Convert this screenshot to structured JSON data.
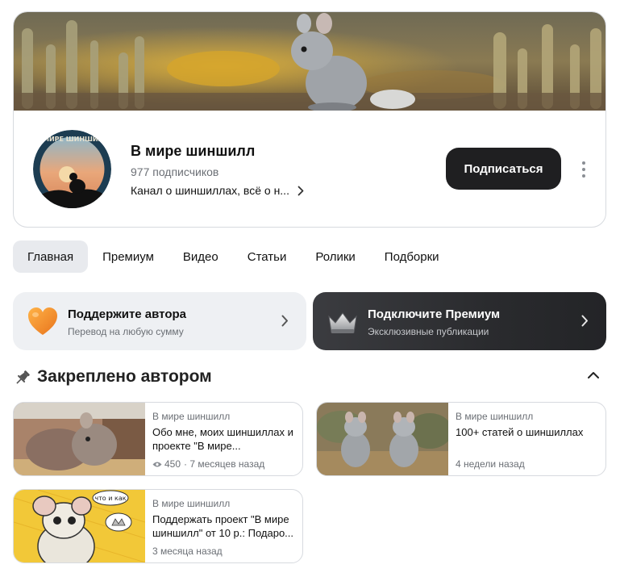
{
  "channel": {
    "name": "В мире шиншилл",
    "subscribers": "977 подписчиков",
    "description": "Канал о шиншиллах, всё о н...",
    "subscribe_label": "Подписаться",
    "avatar_text": "В МИРЕ ШИНШИЛЛ"
  },
  "tabs": [
    {
      "label": "Главная",
      "active": true
    },
    {
      "label": "Премиум"
    },
    {
      "label": "Видео"
    },
    {
      "label": "Статьи"
    },
    {
      "label": "Ролики"
    },
    {
      "label": "Подборки"
    }
  ],
  "promos": {
    "support": {
      "title": "Поддержите автора",
      "subtitle": "Перевод на любую сумму",
      "icon": "heart-icon"
    },
    "premium": {
      "title": "Подключите Премиум",
      "subtitle": "Эксклюзивные публикации",
      "icon": "crown-icon"
    }
  },
  "pinned": {
    "title": "Закреплено автором",
    "posts": [
      {
        "author": "В мире шиншилл",
        "title": "Обо мне, моих шиншиллах и проекте \"В мире...",
        "views": "450",
        "time": "· 7 месяцев назад"
      },
      {
        "author": "В мире шиншилл",
        "title": "100+ статей о шиншиллах",
        "time": "4 недели назад"
      },
      {
        "author": "В мире шиншилл",
        "title": "Поддержать проект \"В мире шиншилл\" от 10 р.: Подаро...",
        "time": "3 месяца назад",
        "bubble": "что и как"
      }
    ]
  },
  "colors": {
    "button_dark": "#1f1f21",
    "tab_active_bg": "#e8eaee",
    "support_bg": "#eef0f3",
    "heart": "#f08a2a"
  }
}
